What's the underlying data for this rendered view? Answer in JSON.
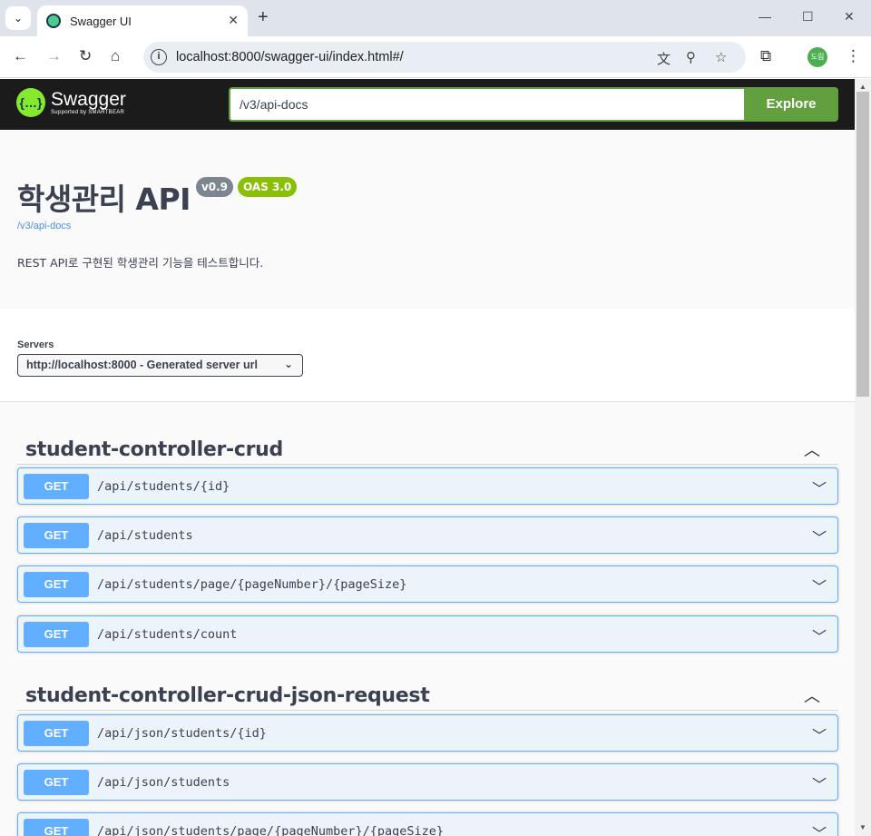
{
  "browser": {
    "tab_title": "Swagger UI",
    "url": "localhost:8000/swagger-ui/index.html#/",
    "profile_initials": "도림"
  },
  "topbar": {
    "logo_name": "Swagger",
    "logo_sub": "Supported by SMARTBEAR",
    "api_url_value": "/v3/api-docs",
    "explore_label": "Explore"
  },
  "info": {
    "title": "학생관리 API",
    "version_badge": "v0.9",
    "oas_badge": "OAS 3.0",
    "spec_link": "/v3/api-docs",
    "description": "REST API로 구현된 학생관리 기능을 테스트합니다."
  },
  "servers": {
    "label": "Servers",
    "selected": "http://localhost:8000 - Generated server url"
  },
  "tags": [
    {
      "name": "student-controller-crud",
      "operations": [
        {
          "method": "GET",
          "path": "/api/students/{id}"
        },
        {
          "method": "GET",
          "path": "/api/students"
        },
        {
          "method": "GET",
          "path": "/api/students/page/{pageNumber}/{pageSize}"
        },
        {
          "method": "GET",
          "path": "/api/students/count"
        }
      ]
    },
    {
      "name": "student-controller-crud-json-request",
      "operations": [
        {
          "method": "GET",
          "path": "/api/json/students/{id}"
        },
        {
          "method": "GET",
          "path": "/api/json/students"
        },
        {
          "method": "GET",
          "path": "/api/json/students/page/{pageNumber}/{pageSize}"
        }
      ]
    }
  ],
  "colors": {
    "get_method": "#61affe",
    "explore_green": "#62a03f",
    "oas_badge": "#89bf04",
    "version_badge": "#7d8492"
  }
}
